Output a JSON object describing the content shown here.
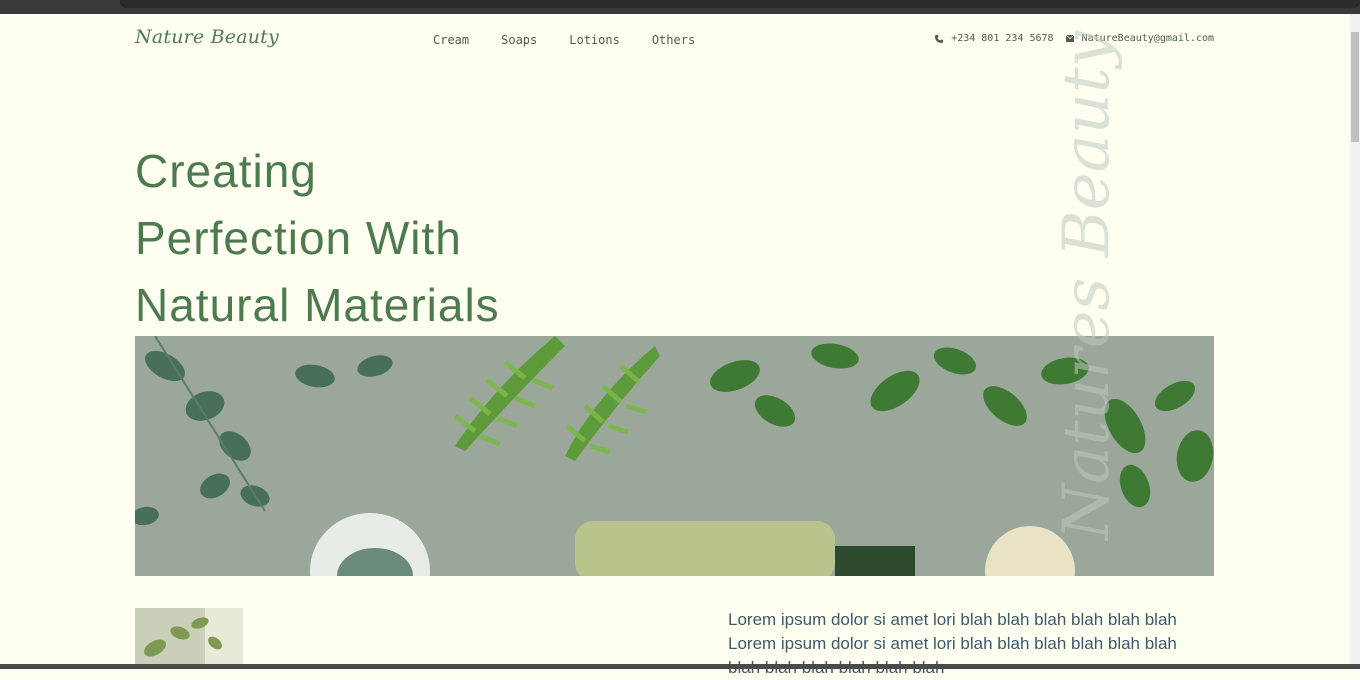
{
  "header": {
    "logo": "Nature Beauty",
    "nav": [
      "Cream",
      "Soaps",
      "Lotions",
      "Others"
    ],
    "phone": "+234 801 234 5678",
    "email": "NatureBeauty@gmail.com"
  },
  "hero": {
    "title_lines": [
      "Creating",
      "Perfection With",
      "Natural Materials"
    ],
    "watermark": "Natures Beauty"
  },
  "content": {
    "paragraph": "Lorem ipsum dolor si amet lori blah blah blah blah blah blah Lorem ipsum dolor si amet lori blah blah blah blah blah blah blah blah blah blah blah blah"
  },
  "colors": {
    "background": "#fefef1",
    "accent": "#4e7a50"
  }
}
